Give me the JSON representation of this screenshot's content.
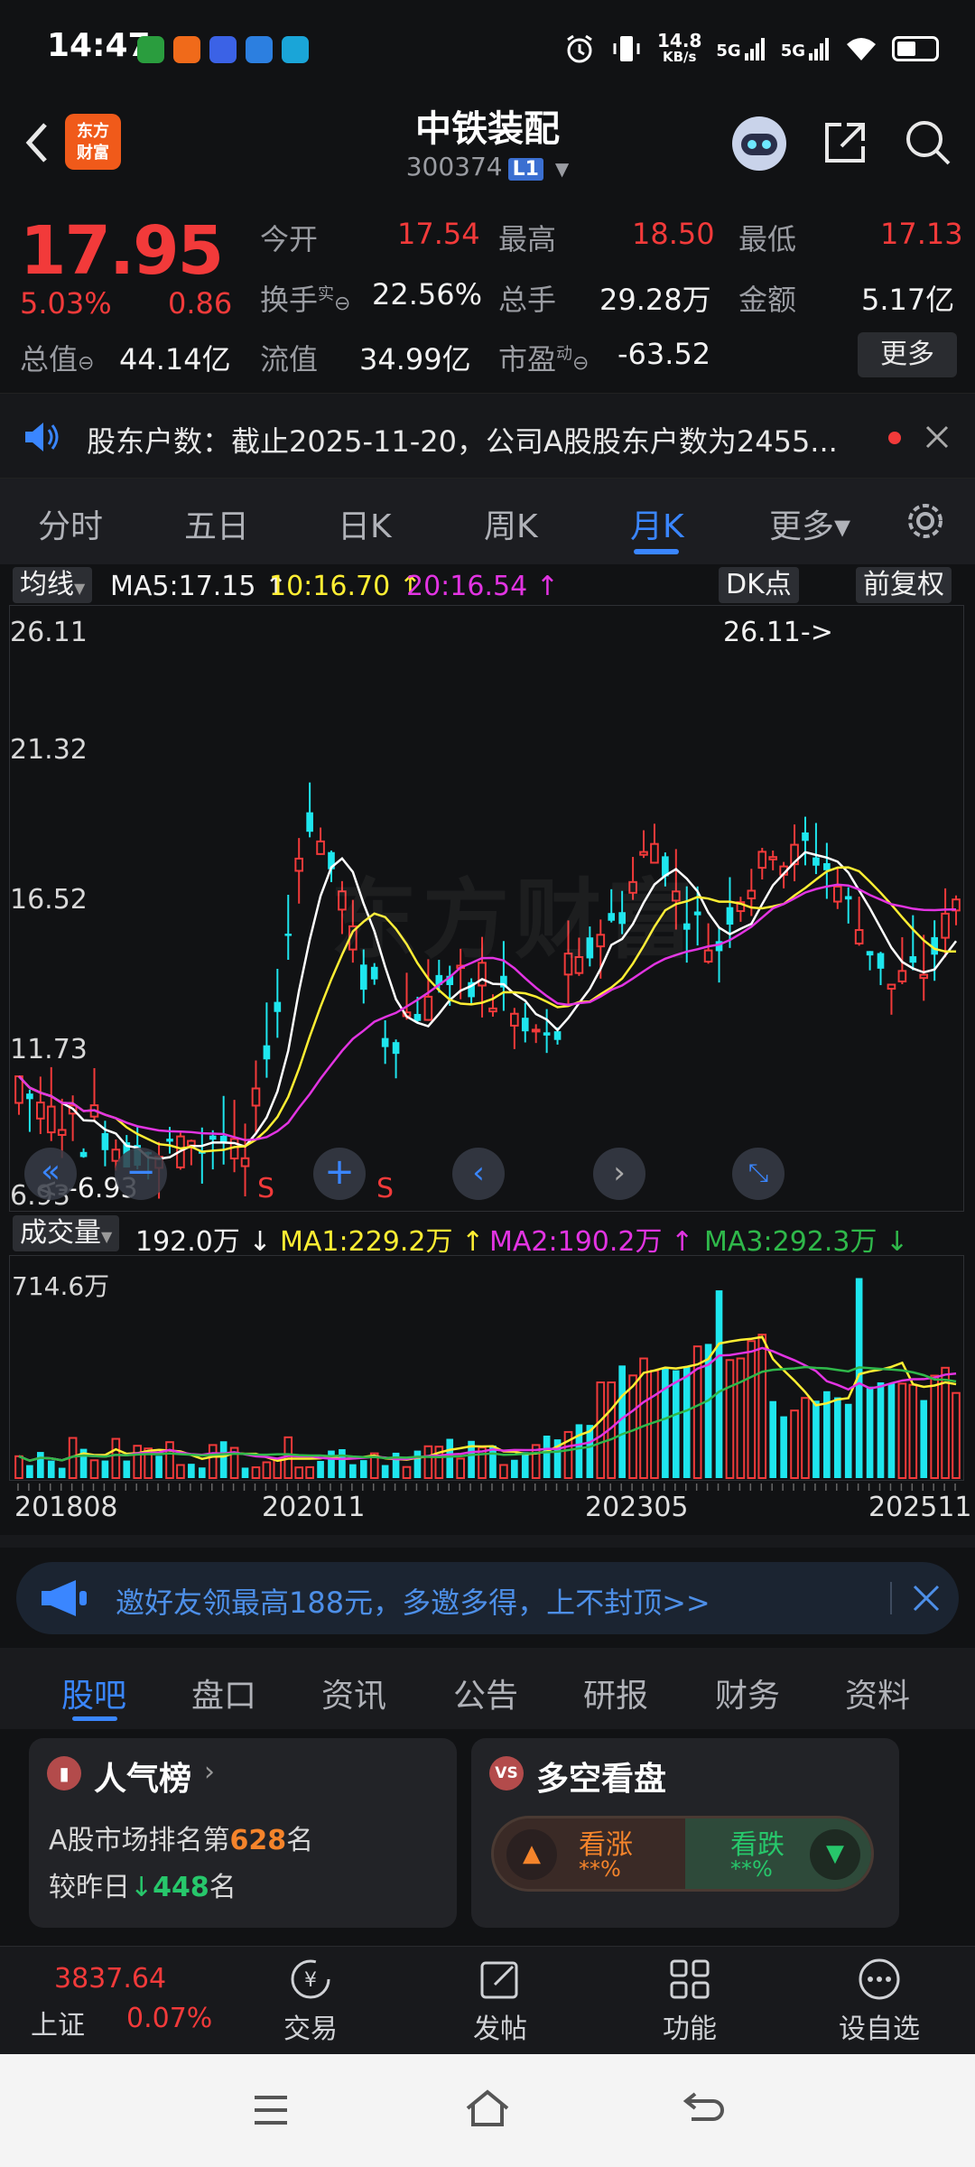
{
  "status_bar": {
    "time": "14:47",
    "net_speed_value": "14.8",
    "net_speed_unit": "KB/s",
    "signal_1": "5G",
    "signal_2": "5G"
  },
  "header": {
    "logo_text_1": "东方",
    "logo_text_2": "财富",
    "title": "中铁装配",
    "code": "300374",
    "level_badge": "L1"
  },
  "quote": {
    "price": "17.95",
    "change_pct": "5.03%",
    "change": "0.86",
    "open_label": "今开",
    "open": "17.54",
    "high_label": "最高",
    "high": "18.50",
    "low_label": "最低",
    "low": "17.13",
    "turnover_label": "换手",
    "turnover_sup": "实",
    "turnover": "22.56%",
    "volume_label": "总手",
    "volume": "29.28万",
    "amount_label": "金额",
    "amount": "5.17亿",
    "mktcap_label": "总值",
    "mktcap": "44.14亿",
    "float_label": "流值",
    "float_cap": "34.99亿",
    "pe_label": "市盈",
    "pe_sup": "动",
    "pe": "-63.52",
    "more_label": "更多"
  },
  "notice": {
    "text": "股东户数：截止2025-11-20，公司A股股东户数为2455..."
  },
  "period_tabs": [
    "分时",
    "五日",
    "日K",
    "周K",
    "月K",
    "更多▾"
  ],
  "active_period": "月K",
  "chart_toolbar": {
    "ma_selector": "均线",
    "ma5": "MA5:17.15 ↑",
    "ma10": "10:16.70 ↑",
    "ma20": "20:16.54 ↑",
    "dk_label": "DK点",
    "adjust_label": "前复权"
  },
  "chart_labels": {
    "y_ticks": [
      "26.11",
      "21.32",
      "16.52",
      "11.73",
      "6.93"
    ],
    "max_marker": "26.11->",
    "min_marker": "<--6.93",
    "s_markers": [
      "S",
      "S"
    ]
  },
  "volume_toolbar": {
    "label": "成交量",
    "vol": "192.0万 ↓",
    "ma1": "MA1:229.2万 ↑",
    "ma2": "MA2:190.2万 ↑",
    "ma3": "MA3:292.3万 ↓",
    "max_tick": "714.6万"
  },
  "x_dates": [
    "201808",
    "202011",
    "202305",
    "202511"
  ],
  "promo": {
    "text": "邀好友领最高188元，多邀多得，上不封顶>>"
  },
  "content_tabs": [
    "股吧",
    "盘口",
    "资讯",
    "公告",
    "研报",
    "财务",
    "资料"
  ],
  "active_content_tab": "股吧",
  "popularity_card": {
    "title": "人气榜",
    "rank_prefix": "A股市场排名第",
    "rank": "628",
    "rank_suffix": "名",
    "change_prefix": "较昨日",
    "change_value": "448",
    "change_suffix": "名"
  },
  "sentiment_card": {
    "title": "多空看盘",
    "badge": "VS",
    "bull_label": "看涨",
    "bull_value": "**%",
    "bear_label": "看跌",
    "bear_value": "**%"
  },
  "bottom_nav": {
    "index_value": "3837.64",
    "index_name": "上证",
    "index_change": "0.07%",
    "items": [
      "交易",
      "发帖",
      "功能",
      "设自选"
    ]
  },
  "watermark": "东方财富",
  "colors": {
    "up": "#f23a3a",
    "down": "#1ee6ee",
    "accent": "#3a86ff",
    "ma5": "#ffffff",
    "ma10": "#ffee33",
    "ma20": "#e234e2",
    "ma3_vol": "#2fb84a"
  }
}
